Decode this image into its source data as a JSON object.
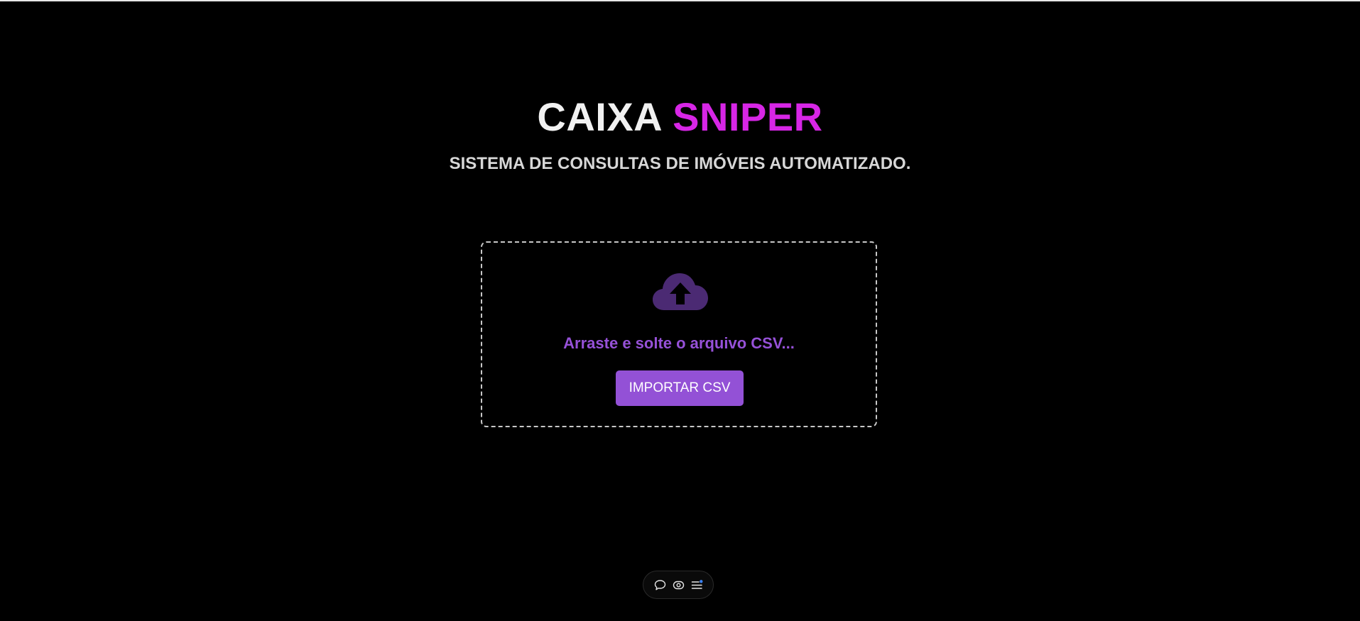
{
  "app": {
    "title_part1": "CAIXA",
    "title_part2": "SNIPER",
    "subtitle": "SISTEMA DE CONSULTAS DE IMÓVEIS AUTOMATIZADO."
  },
  "upload": {
    "icon": "cloud-upload-icon",
    "prompt": "Arraste e solte o arquivo CSV...",
    "button_label": "IMPORTAR CSV"
  },
  "toolbar": {
    "items": [
      {
        "icon": "chat-bubble-icon"
      },
      {
        "icon": "eye-icon"
      },
      {
        "icon": "list-menu-icon"
      }
    ]
  },
  "colors": {
    "background": "#000000",
    "title_primary": "#f1f1f1",
    "title_accent": "#d726e6",
    "subtitle": "#d7d7d7",
    "accent_purple": "#9351d6",
    "icon_purple": "#4b2a73",
    "dropzone_border": "#c8c8c8",
    "notification_dot": "#3b82f6"
  }
}
